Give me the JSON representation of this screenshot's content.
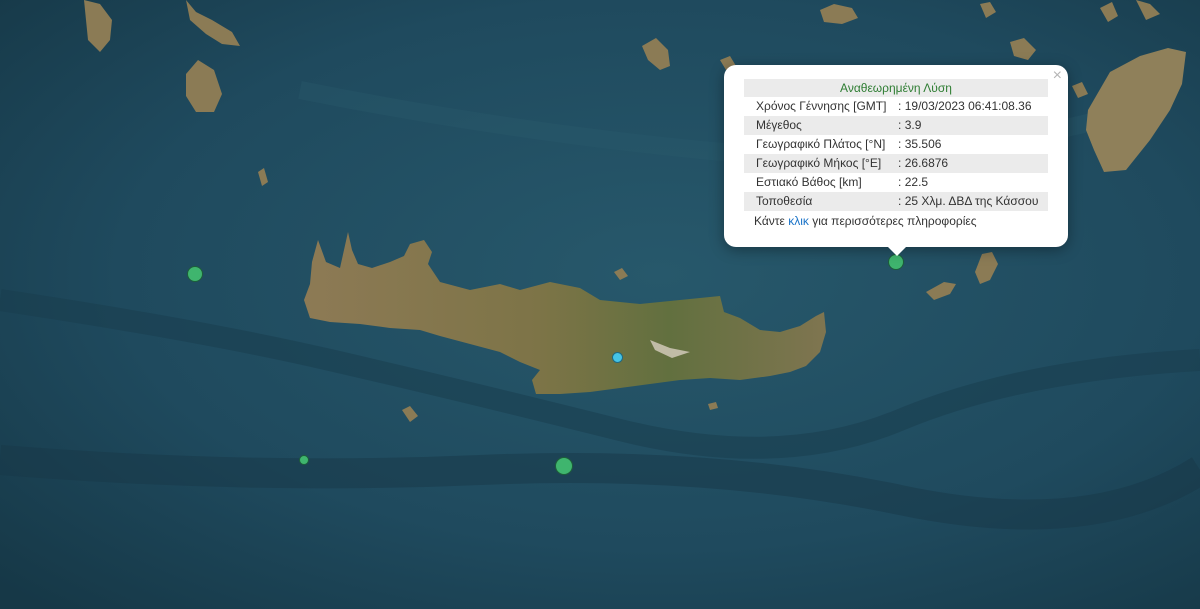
{
  "popup": {
    "title": "Αναθεωρημένη Λύση",
    "close_symbol": "×",
    "rows": [
      {
        "label": "Χρόνος Γέννησης [GMT]",
        "value": ": 19/03/2023 06:41:08.36"
      },
      {
        "label": "Μέγεθος",
        "value": ": 3.9"
      },
      {
        "label": "Γεωγραφικό Πλάτος [°N]",
        "value": ": 35.506"
      },
      {
        "label": "Γεωγραφικό Μήκος [°E]",
        "value": ": 26.6876"
      },
      {
        "label": "Εστιακό Βάθος [km]",
        "value": ": 22.5"
      },
      {
        "label": "Τοποθεσία",
        "value": ": 25 Χλμ. ΔΒΔ της Κάσσου"
      }
    ],
    "more_prefix": "Κάντε ",
    "more_link": "κλικ",
    "more_suffix": " για περισσότερες πληροφορίες"
  },
  "colors": {
    "sea": "#1f4a5e",
    "land": "#8a7a52",
    "marker_green": "#3fb56e",
    "marker_cyan": "#45c4e6",
    "popup_title": "#2e7d32",
    "link": "#1a73c8"
  }
}
